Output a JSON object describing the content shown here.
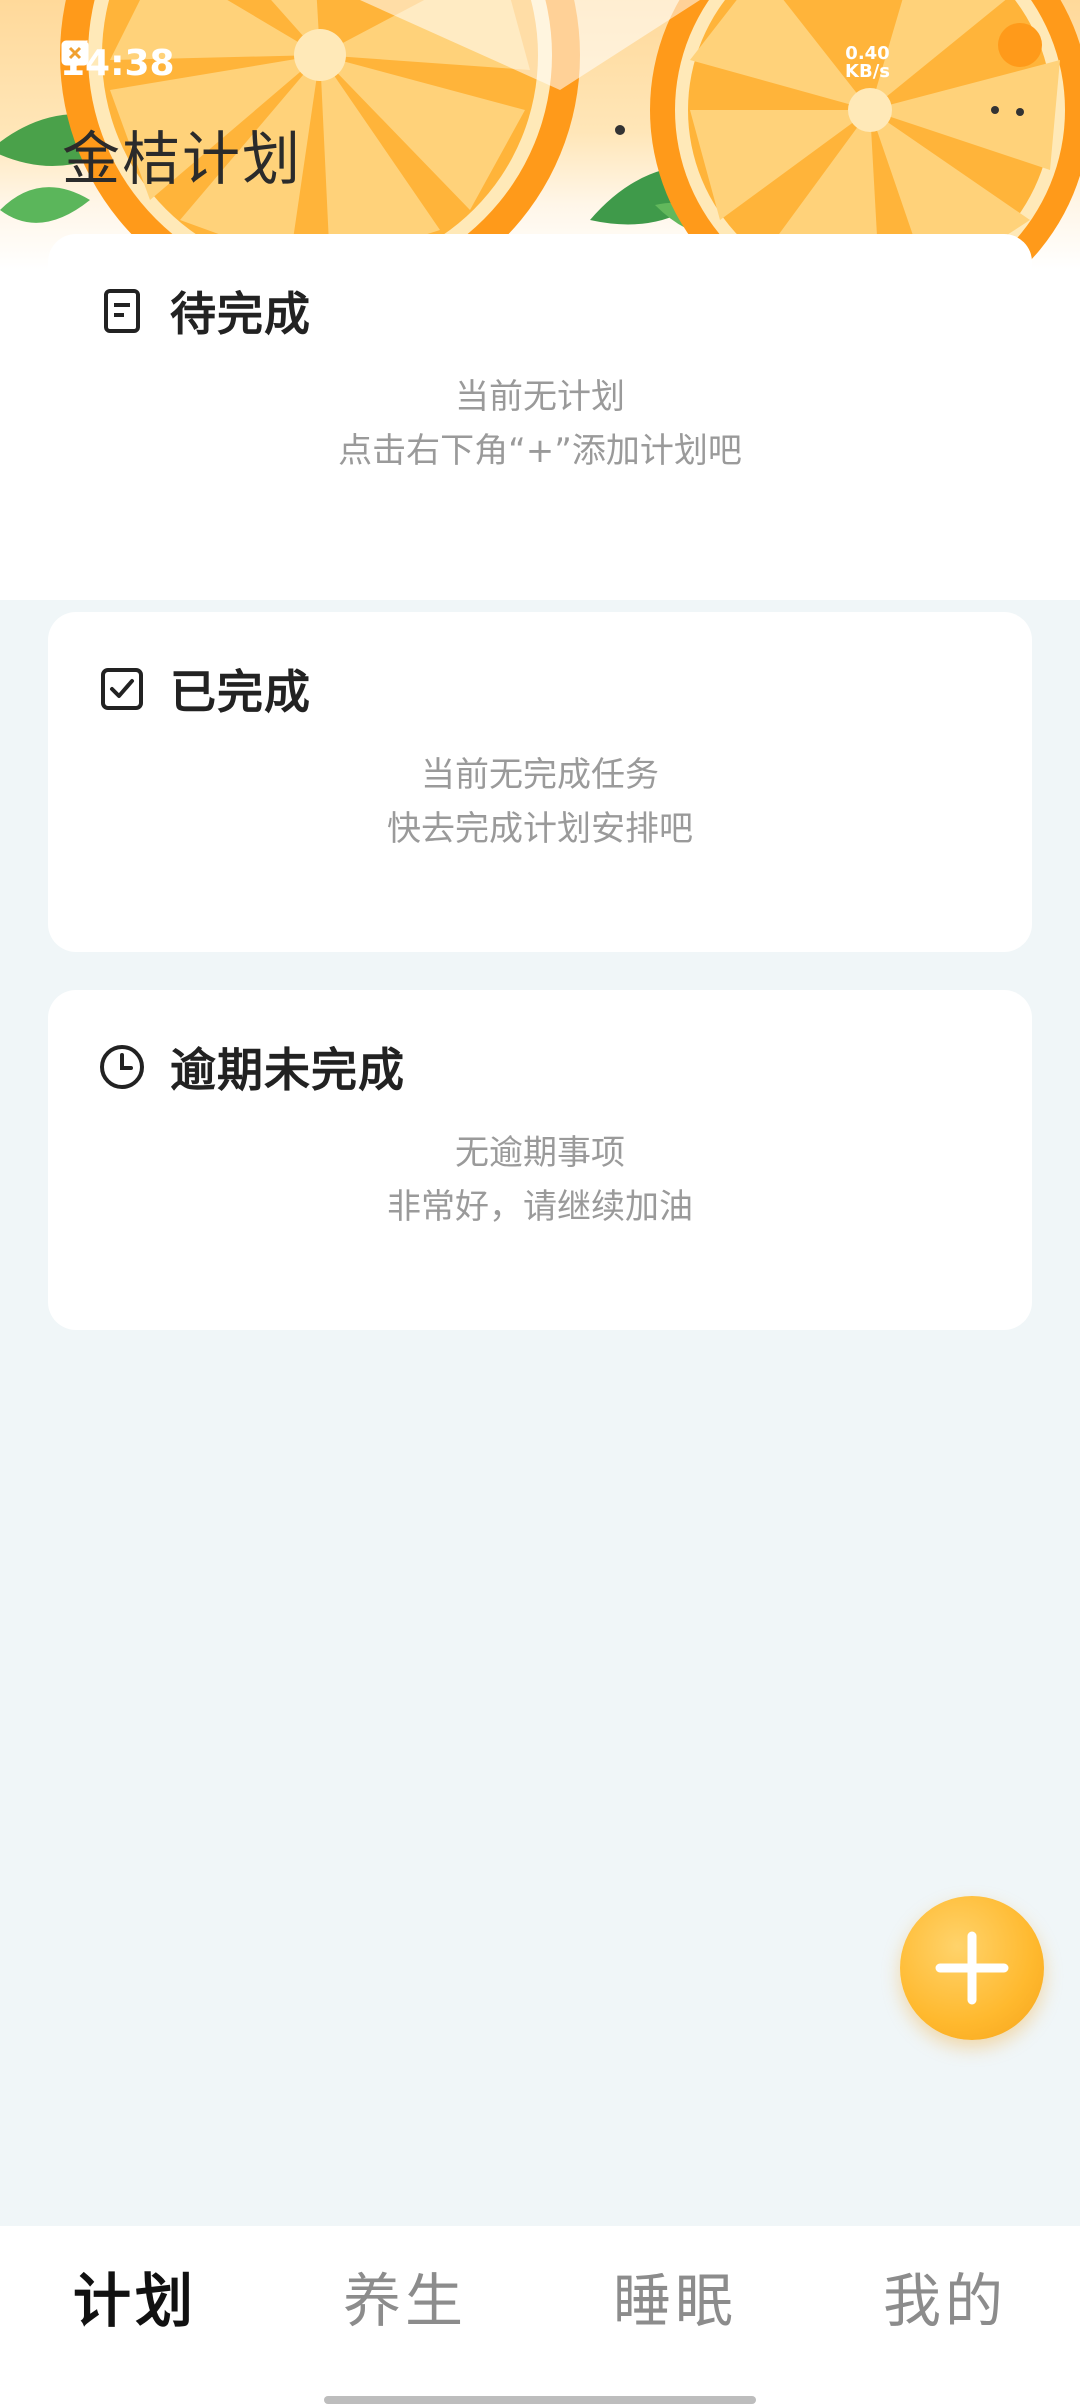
{
  "status_bar": {
    "time": "14:38",
    "net_speed_value": "0.40",
    "net_speed_unit": "KB/s"
  },
  "app": {
    "title": "金桔计划"
  },
  "cards": [
    {
      "title": "待完成",
      "icon": "document-icon",
      "line1": "当前无计划",
      "line2": "点击右下角“+”添加计划吧"
    },
    {
      "title": "已完成",
      "icon": "checkbox-icon",
      "line1": "当前无完成任务",
      "line2": "快去完成计划安排吧"
    },
    {
      "title": "逾期未完成",
      "icon": "clock-icon",
      "line1": "无逾期事项",
      "line2": "非常好，请继续加油"
    }
  ],
  "fab": {
    "icon": "plus-icon"
  },
  "tabs": [
    {
      "label": "计划",
      "active": true
    },
    {
      "label": "养生",
      "active": false
    },
    {
      "label": "睡眠",
      "active": false
    },
    {
      "label": "我的",
      "active": false
    }
  ],
  "colors": {
    "accent": "#ffb92e",
    "background": "#f0f6f8",
    "card": "#ffffff",
    "muted_text": "#9a9a9a"
  }
}
